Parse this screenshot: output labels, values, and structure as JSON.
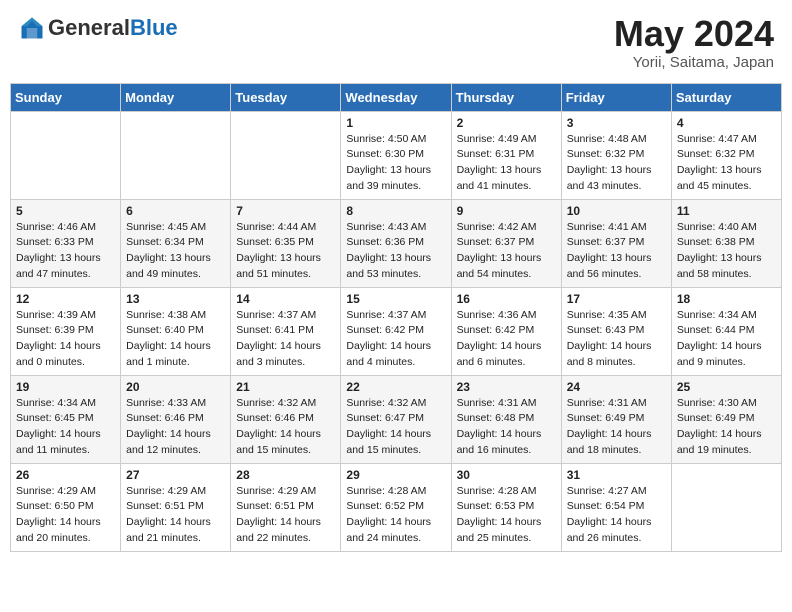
{
  "header": {
    "logo_general": "General",
    "logo_blue": "Blue",
    "month": "May 2024",
    "location": "Yorii, Saitama, Japan"
  },
  "days_of_week": [
    "Sunday",
    "Monday",
    "Tuesday",
    "Wednesday",
    "Thursday",
    "Friday",
    "Saturday"
  ],
  "weeks": [
    [
      {
        "day": "",
        "info": ""
      },
      {
        "day": "",
        "info": ""
      },
      {
        "day": "",
        "info": ""
      },
      {
        "day": "1",
        "info": "Sunrise: 4:50 AM\nSunset: 6:30 PM\nDaylight: 13 hours\nand 39 minutes."
      },
      {
        "day": "2",
        "info": "Sunrise: 4:49 AM\nSunset: 6:31 PM\nDaylight: 13 hours\nand 41 minutes."
      },
      {
        "day": "3",
        "info": "Sunrise: 4:48 AM\nSunset: 6:32 PM\nDaylight: 13 hours\nand 43 minutes."
      },
      {
        "day": "4",
        "info": "Sunrise: 4:47 AM\nSunset: 6:32 PM\nDaylight: 13 hours\nand 45 minutes."
      }
    ],
    [
      {
        "day": "5",
        "info": "Sunrise: 4:46 AM\nSunset: 6:33 PM\nDaylight: 13 hours\nand 47 minutes."
      },
      {
        "day": "6",
        "info": "Sunrise: 4:45 AM\nSunset: 6:34 PM\nDaylight: 13 hours\nand 49 minutes."
      },
      {
        "day": "7",
        "info": "Sunrise: 4:44 AM\nSunset: 6:35 PM\nDaylight: 13 hours\nand 51 minutes."
      },
      {
        "day": "8",
        "info": "Sunrise: 4:43 AM\nSunset: 6:36 PM\nDaylight: 13 hours\nand 53 minutes."
      },
      {
        "day": "9",
        "info": "Sunrise: 4:42 AM\nSunset: 6:37 PM\nDaylight: 13 hours\nand 54 minutes."
      },
      {
        "day": "10",
        "info": "Sunrise: 4:41 AM\nSunset: 6:37 PM\nDaylight: 13 hours\nand 56 minutes."
      },
      {
        "day": "11",
        "info": "Sunrise: 4:40 AM\nSunset: 6:38 PM\nDaylight: 13 hours\nand 58 minutes."
      }
    ],
    [
      {
        "day": "12",
        "info": "Sunrise: 4:39 AM\nSunset: 6:39 PM\nDaylight: 14 hours\nand 0 minutes."
      },
      {
        "day": "13",
        "info": "Sunrise: 4:38 AM\nSunset: 6:40 PM\nDaylight: 14 hours\nand 1 minute."
      },
      {
        "day": "14",
        "info": "Sunrise: 4:37 AM\nSunset: 6:41 PM\nDaylight: 14 hours\nand 3 minutes."
      },
      {
        "day": "15",
        "info": "Sunrise: 4:37 AM\nSunset: 6:42 PM\nDaylight: 14 hours\nand 4 minutes."
      },
      {
        "day": "16",
        "info": "Sunrise: 4:36 AM\nSunset: 6:42 PM\nDaylight: 14 hours\nand 6 minutes."
      },
      {
        "day": "17",
        "info": "Sunrise: 4:35 AM\nSunset: 6:43 PM\nDaylight: 14 hours\nand 8 minutes."
      },
      {
        "day": "18",
        "info": "Sunrise: 4:34 AM\nSunset: 6:44 PM\nDaylight: 14 hours\nand 9 minutes."
      }
    ],
    [
      {
        "day": "19",
        "info": "Sunrise: 4:34 AM\nSunset: 6:45 PM\nDaylight: 14 hours\nand 11 minutes."
      },
      {
        "day": "20",
        "info": "Sunrise: 4:33 AM\nSunset: 6:46 PM\nDaylight: 14 hours\nand 12 minutes."
      },
      {
        "day": "21",
        "info": "Sunrise: 4:32 AM\nSunset: 6:46 PM\nDaylight: 14 hours\nand 15 minutes."
      },
      {
        "day": "22",
        "info": "Sunrise: 4:32 AM\nSunset: 6:47 PM\nDaylight: 14 hours\nand 15 minutes."
      },
      {
        "day": "23",
        "info": "Sunrise: 4:31 AM\nSunset: 6:48 PM\nDaylight: 14 hours\nand 16 minutes."
      },
      {
        "day": "24",
        "info": "Sunrise: 4:31 AM\nSunset: 6:49 PM\nDaylight: 14 hours\nand 18 minutes."
      },
      {
        "day": "25",
        "info": "Sunrise: 4:30 AM\nSunset: 6:49 PM\nDaylight: 14 hours\nand 19 minutes."
      }
    ],
    [
      {
        "day": "26",
        "info": "Sunrise: 4:29 AM\nSunset: 6:50 PM\nDaylight: 14 hours\nand 20 minutes."
      },
      {
        "day": "27",
        "info": "Sunrise: 4:29 AM\nSunset: 6:51 PM\nDaylight: 14 hours\nand 21 minutes."
      },
      {
        "day": "28",
        "info": "Sunrise: 4:29 AM\nSunset: 6:51 PM\nDaylight: 14 hours\nand 22 minutes."
      },
      {
        "day": "29",
        "info": "Sunrise: 4:28 AM\nSunset: 6:52 PM\nDaylight: 14 hours\nand 24 minutes."
      },
      {
        "day": "30",
        "info": "Sunrise: 4:28 AM\nSunset: 6:53 PM\nDaylight: 14 hours\nand 25 minutes."
      },
      {
        "day": "31",
        "info": "Sunrise: 4:27 AM\nSunset: 6:54 PM\nDaylight: 14 hours\nand 26 minutes."
      },
      {
        "day": "",
        "info": ""
      }
    ]
  ]
}
